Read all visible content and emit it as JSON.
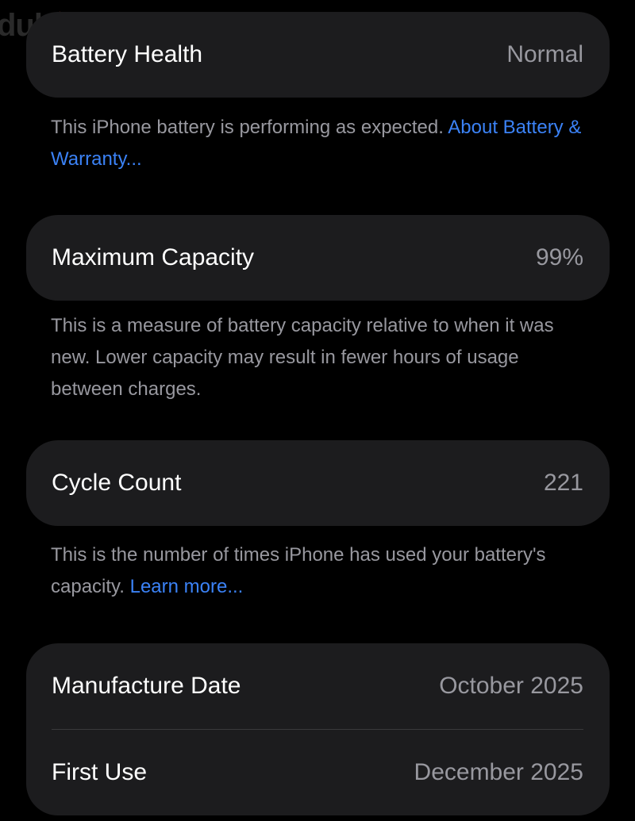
{
  "watermark": {
    "text": "dub"
  },
  "battery_health": {
    "label": "Battery Health",
    "value": "Normal",
    "description": "This iPhone battery is performing as expected. ",
    "link": "About Battery & Warranty..."
  },
  "maximum_capacity": {
    "label": "Maximum Capacity",
    "value": "99%",
    "description": "This is a measure of battery capacity relative to when it was new. Lower capacity may result in fewer hours of usage between charges."
  },
  "cycle_count": {
    "label": "Cycle Count",
    "value": "221",
    "description": "This is the number of times iPhone has used your battery's capacity. ",
    "link": "Learn more..."
  },
  "dates": {
    "manufacture_label": "Manufacture Date",
    "manufacture_value": "October 2025",
    "first_use_label": "First Use",
    "first_use_value": "December 2025"
  },
  "colors": {
    "background": "#000000",
    "card": "#1c1c1e",
    "secondary_text": "#98989f",
    "link": "#3b82f6"
  }
}
